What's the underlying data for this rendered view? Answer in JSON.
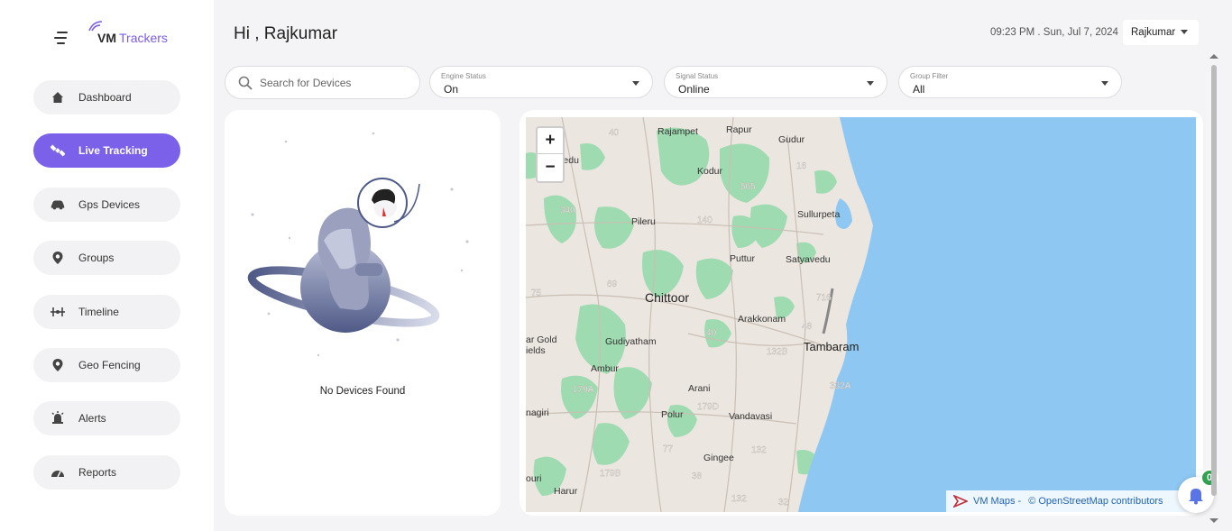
{
  "brand": {
    "vm": "VM",
    "trackers": "Trackers"
  },
  "nav": [
    {
      "label": "Dashboard",
      "icon": "home-icon",
      "active": false
    },
    {
      "label": "Live Tracking",
      "icon": "satellite-icon",
      "active": true
    },
    {
      "label": "Gps Devices",
      "icon": "car-icon",
      "active": false
    },
    {
      "label": "Groups",
      "icon": "location-pin-icon",
      "active": false
    },
    {
      "label": "Timeline",
      "icon": "timeline-icon",
      "active": false
    },
    {
      "label": "Geo Fencing",
      "icon": "geofence-pin-icon",
      "active": false
    },
    {
      "label": "Alerts",
      "icon": "alarm-icon",
      "active": false
    },
    {
      "label": "Reports",
      "icon": "speedometer-icon",
      "active": false
    }
  ],
  "header": {
    "greeting": "Hi ,  Rajkumar",
    "datetime": "09:23 PM . Sun, Jul 7, 2024",
    "user": "Rajkumar"
  },
  "filters": {
    "search_placeholder": "Search for Devices",
    "engine": {
      "label": "Engine Status",
      "value": "On"
    },
    "signal": {
      "label": "Signal Status",
      "value": "Online"
    },
    "group": {
      "label": "Group Filter",
      "value": "All"
    }
  },
  "devices": {
    "empty_text": "No Devices Found"
  },
  "map": {
    "zoom_in": "+",
    "zoom_out": "−",
    "attribution_brand": "VM Maps -",
    "attribution_osm": "© OpenStreetMap contributors",
    "places": [
      "Rajampet",
      "Rapur",
      "Gudur",
      "Kodur",
      "Sullurpeta",
      "Pileru",
      "Puttur",
      "Satyavedu",
      "Chittoor",
      "Arakkonam",
      "Tambaram",
      "Gudiyatham",
      "Ambur",
      "Arani",
      "Polur",
      "Vandavasi",
      "Gingee",
      "Harur",
      "iveedu",
      "ar Gold",
      "ields",
      "nagiri",
      "ouri"
    ],
    "roads": [
      "40",
      "565",
      "716",
      "340",
      "140",
      "75",
      "69",
      "716",
      "48",
      "40",
      "132B",
      "179A",
      "179D",
      "332A",
      "77",
      "132",
      "179B",
      "38",
      "132",
      "32",
      "16"
    ],
    "colors": {
      "sea": "#8ec8f2",
      "land": "#ece6e0",
      "forest": "#9fdbb0"
    }
  },
  "notifications": {
    "count": "0"
  }
}
